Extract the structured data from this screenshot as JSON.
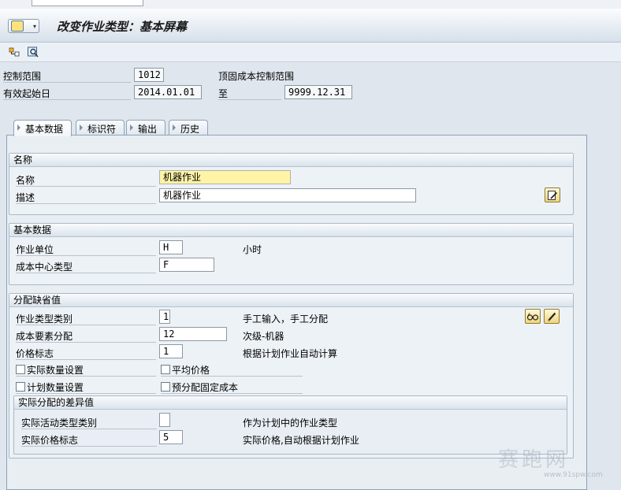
{
  "title": "改变作业类型：基本屏幕",
  "header": {
    "controlling_area_label": "控制范围",
    "controlling_area_value": "1012",
    "controlling_area_desc": "顶固成本控制范围",
    "valid_from_label": "有效起始日",
    "valid_from_value": "2014.01.01",
    "valid_to_label": "至",
    "valid_to_value": "9999.12.31"
  },
  "tabs": [
    {
      "label": "基本数据",
      "active": true
    },
    {
      "label": "标识符",
      "active": false
    },
    {
      "label": "输出",
      "active": false
    },
    {
      "label": "历史",
      "active": false
    }
  ],
  "name_group": {
    "title": "名称",
    "name_label": "名称",
    "name_value": "机器作业",
    "desc_label": "描述",
    "desc_value": "机器作业"
  },
  "basic_group": {
    "title": "基本数据",
    "unit_label": "作业单位",
    "unit_value": "H",
    "unit_text": "小时",
    "cctype_label": "成本中心类型",
    "cctype_value": "F"
  },
  "alloc_group": {
    "title": "分配缺省值",
    "category_label": "作业类型类别",
    "category_value": "1",
    "category_text": "手工输入，手工分配",
    "cost_element_label": "成本要素分配",
    "cost_element_value": "12",
    "cost_element_text": "次级-机器",
    "price_ind_label": "价格标志",
    "price_ind_value": "1",
    "price_ind_text": "根据计划作业自动计算",
    "actual_qty_label": "实际数量设置",
    "avg_price_label": "平均价格",
    "plan_qty_label": "计划数量设置",
    "predistrib_label": "预分配固定成本"
  },
  "variance_group": {
    "title": "实际分配的差异值",
    "actual_cat_label": "实际活动类型类别",
    "actual_cat_value": "",
    "actual_cat_text": "作为计划中的作业类型",
    "actual_price_label": "实际价格标志",
    "actual_price_value": "5",
    "actual_price_text": "实际价格,自动根据计划作业"
  },
  "watermark": {
    "text": "赛跑网",
    "url": "www.91spw.com"
  },
  "colors": {
    "focus_field": "#fff3a6",
    "panel": "#e9eef3",
    "title_bar": "#d6e0ea"
  }
}
